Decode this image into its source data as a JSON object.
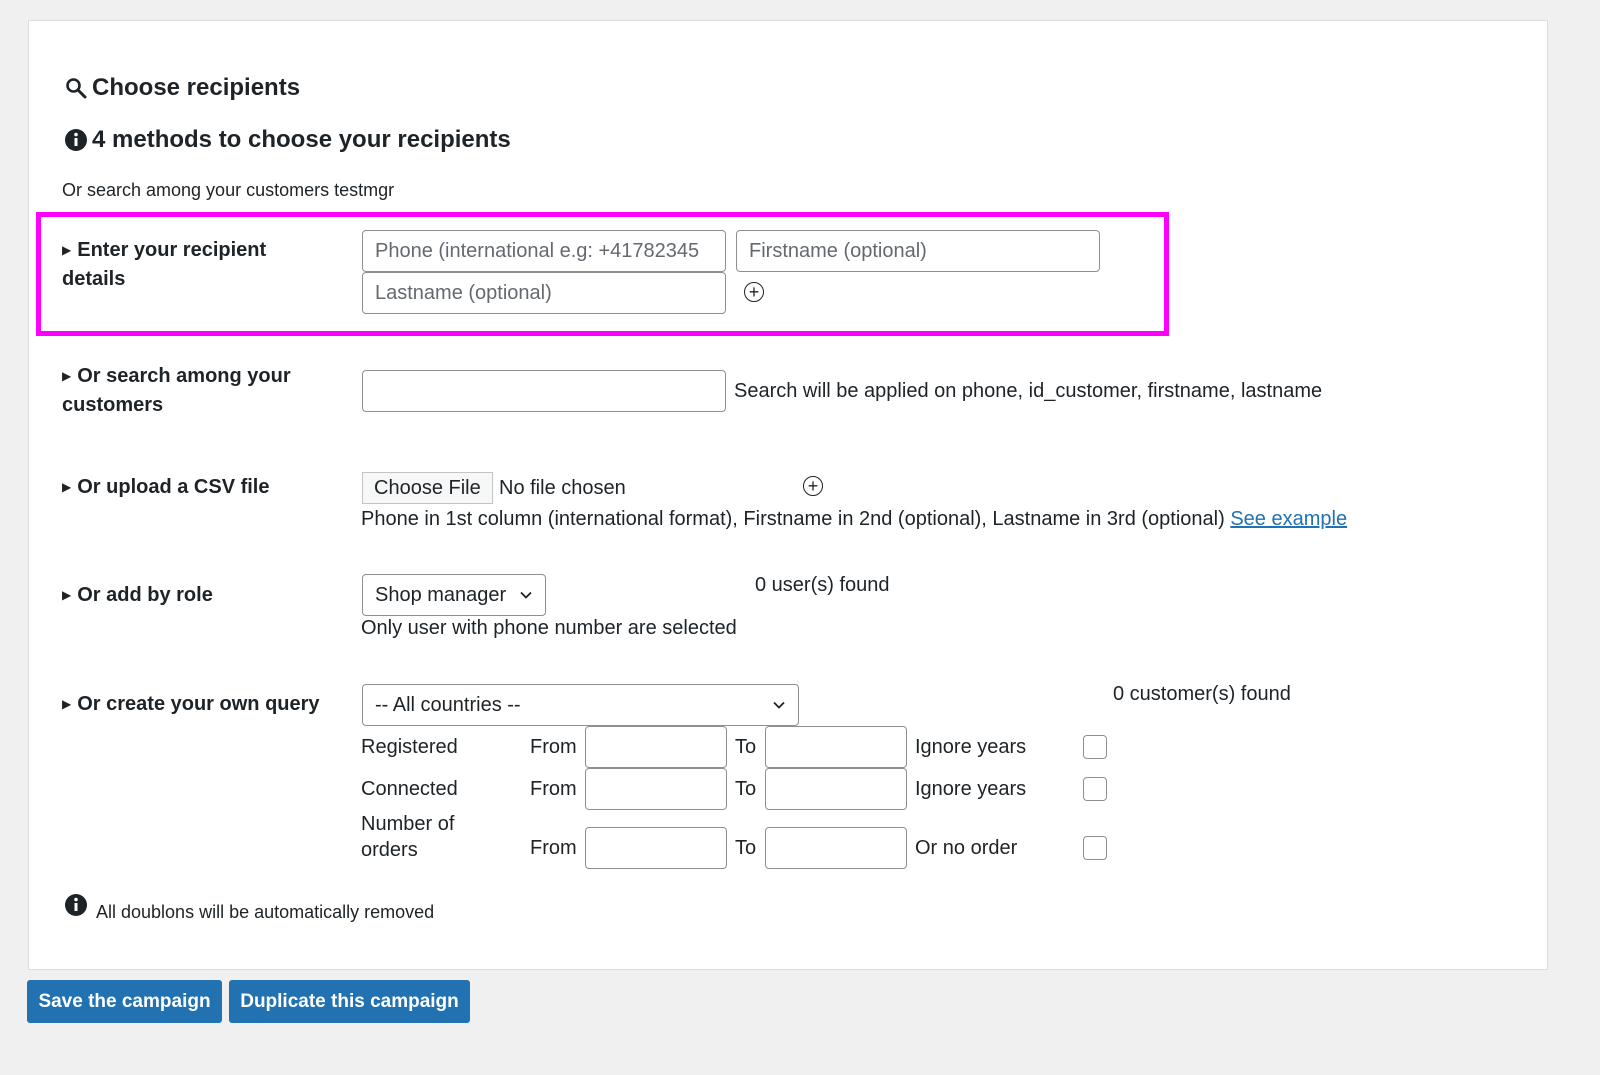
{
  "section": {
    "title": "Choose recipients",
    "methods_title": "4 methods to choose your recipients",
    "intro": "Or search among your customers testmgr"
  },
  "manual": {
    "label": "Enter your recipient details",
    "phone_placeholder": "Phone (international e.g: +41782345",
    "firstname_placeholder": "Firstname (optional)",
    "lastname_placeholder": "Lastname (optional)"
  },
  "search": {
    "label": "Or search among your customers",
    "value": "",
    "hint": "Search will be applied on phone, id_customer, firstname, lastname"
  },
  "csv": {
    "label": "Or upload a CSV file",
    "choose_button": "Choose File",
    "no_file": "No file chosen",
    "hint": "Phone in 1st column (international format), Firstname in 2nd (optional), Lastname in 3rd (optional)",
    "example_link": "See example"
  },
  "role": {
    "label": "Or add by role",
    "selected": "Shop manager",
    "found": "0 user(s) found",
    "hint": "Only user with phone number are selected"
  },
  "query": {
    "label": "Or create your own query",
    "country_selected": "-- All countries --",
    "found": "0 customer(s) found",
    "rows": [
      {
        "label": "Registered",
        "from": "From",
        "to": "To",
        "option": "Ignore years"
      },
      {
        "label": "Connected",
        "from": "From",
        "to": "To",
        "option": "Ignore years"
      },
      {
        "label": "Number of orders",
        "from": "From",
        "to": "To",
        "option": "Or no order"
      }
    ]
  },
  "footer_note": "All doublons will be automatically removed",
  "buttons": {
    "save": "Save the campaign",
    "duplicate": "Duplicate this campaign"
  },
  "colors": {
    "highlight": "#ff00ff",
    "primary": "#2271b1"
  }
}
